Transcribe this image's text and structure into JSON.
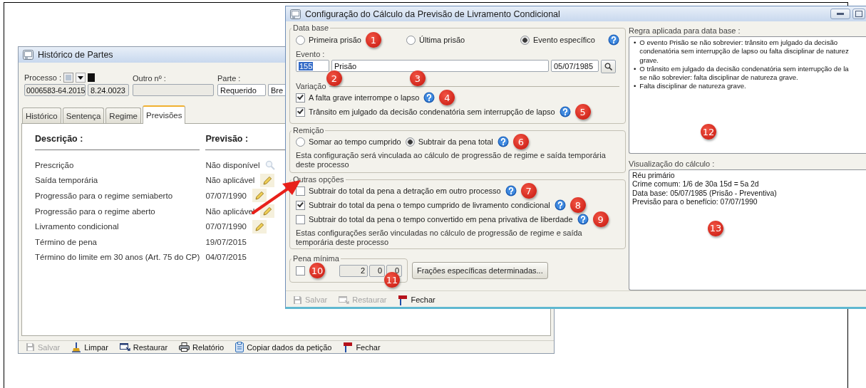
{
  "history_window": {
    "title": "Histórico de Partes",
    "processo": {
      "label": "Processo :",
      "number": "0006583-64.2015",
      "suffix": "8.24.0023"
    },
    "outro": {
      "label": "Outro nº :"
    },
    "parte": {
      "label": "Parte :",
      "value": "Requerido",
      "value_2": "Bre"
    },
    "tabs": [
      {
        "label": "Histórico",
        "selected": false
      },
      {
        "label": "Sentença",
        "selected": false
      },
      {
        "label": "Regime",
        "selected": false
      },
      {
        "label": "Previsões",
        "selected": true
      }
    ],
    "table": {
      "columns": [
        "Descrição :",
        "Previsão :"
      ],
      "rows": [
        {
          "description": "Prescrição",
          "forecast": "Não disponível",
          "kind": "view"
        },
        {
          "description": "Saída temporária",
          "forecast": "Não aplicável",
          "kind": "edit"
        },
        {
          "description": "Progressão para o regime semiaberto",
          "forecast": "07/07/1990",
          "kind": "edit"
        },
        {
          "description": "Progressão para o regime aberto",
          "forecast": "Não aplicável",
          "kind": "edit"
        },
        {
          "description": "Livramento condicional",
          "forecast": "07/07/1990",
          "kind": "edit"
        },
        {
          "description": "Término de pena",
          "forecast": "19/07/2015"
        },
        {
          "description": "Término do limite em 30 anos (Art. 75 do CP)",
          "forecast": "04/07/2015"
        }
      ]
    },
    "toolbar": [
      {
        "label": "Salvar",
        "kind": "save",
        "disabled": true
      },
      {
        "label": "Limpar",
        "kind": "broom",
        "disabled": false
      },
      {
        "label": "Restaurar",
        "kind": "restore",
        "disabled": false
      },
      {
        "label": "Relatório",
        "kind": "printer",
        "disabled": false
      },
      {
        "label": "Copiar dados da petição",
        "kind": "clipboard",
        "disabled": false
      },
      {
        "label": "Fechar",
        "kind": "flag",
        "disabled": false
      }
    ]
  },
  "dialog": {
    "title": "Configuração do Cálculo da Previsão de Livramento Condicional",
    "data_base": {
      "legend": "Data base",
      "options": [
        {
          "label": "Primeira prisão",
          "selected": false,
          "badge": "1"
        },
        {
          "label": "Última prisão",
          "selected": false
        },
        {
          "label": "Evento específico",
          "selected": true
        }
      ]
    },
    "evento": {
      "label": "Evento :",
      "code": "155",
      "code_badge": "2",
      "name": "Prisão",
      "name_badge": "3",
      "date": "05/07/1985"
    },
    "variacao": {
      "legend": "Variação",
      "options": [
        {
          "label": "A falta grave interrompe o lapso",
          "checked": true,
          "badge": "4"
        },
        {
          "label": "Trânsito em julgado da decisão condenatória sem interrupção de lapso",
          "checked": true,
          "badge": "5"
        }
      ]
    },
    "remicao": {
      "legend": "Remição",
      "options": [
        {
          "label": "Somar ao tempo cumprido",
          "selected": false
        },
        {
          "label": "Subtrair da pena total",
          "selected": true,
          "badge": "6"
        }
      ],
      "note": "Esta configuração será vinculada ao cálculo de progressão de regime e saída temporária deste processo"
    },
    "outras": {
      "legend": "Outras opções",
      "options": [
        {
          "label": "Subtrair do total da pena a detração em outro processo",
          "checked": false,
          "badge": "7"
        },
        {
          "label": "Subtrair do total da pena o tempo cumprido de livramento condicional",
          "checked": true,
          "badge": "8"
        },
        {
          "label": "Subtrair do total da pena o tempo convertido em pena privativa de liberdade",
          "checked": false,
          "badge": "9"
        }
      ],
      "note": "Estas configurações serão vinculadas no cálculo de progressão de regime e saída temporária deste processo"
    },
    "pena_minima": {
      "legend": "Pena mínima",
      "checked": false,
      "badge": "10",
      "values": [
        "2",
        "0",
        "0"
      ],
      "values_badge": "11"
    },
    "fractions_button": "Frações específicas determinadas...",
    "rule": {
      "label": "Regra aplicada para data base :",
      "badge": "12",
      "items": [
        {
          "bullet": "•",
          "lines": [
            "O evento Prisão se não sobrevier: trânsito em julgado da decisão",
            "condenatória sem interrupção de lapso ou falta disciplinar de naturez",
            "grave."
          ]
        },
        {
          "bullet": "•",
          "lines": [
            "O trânsito em julgado da decisão condenatória sem interrupção de la",
            "se não sobrevier: falta disciplinar de natureza grave."
          ]
        },
        {
          "bullet": "•",
          "lines": [
            "Falta disciplinar de natureza grave."
          ]
        }
      ]
    },
    "calc": {
      "label": "Visualização do cálculo :",
      "badge": "13",
      "lines": [
        "Réu primário",
        "Crime comum: 1/6 de 30a 15d = 5a 2d",
        "Data base: 05/07/1985 (Prisão - Preventiva)",
        "Previsão para o benefício: 07/07/1990"
      ]
    },
    "toolbar": [
      {
        "label": "Salvar",
        "kind": "save",
        "disabled": true
      },
      {
        "label": "Restaurar",
        "kind": "restore",
        "disabled": true
      },
      {
        "label": "Fechar",
        "kind": "flag",
        "disabled": false
      }
    ]
  }
}
